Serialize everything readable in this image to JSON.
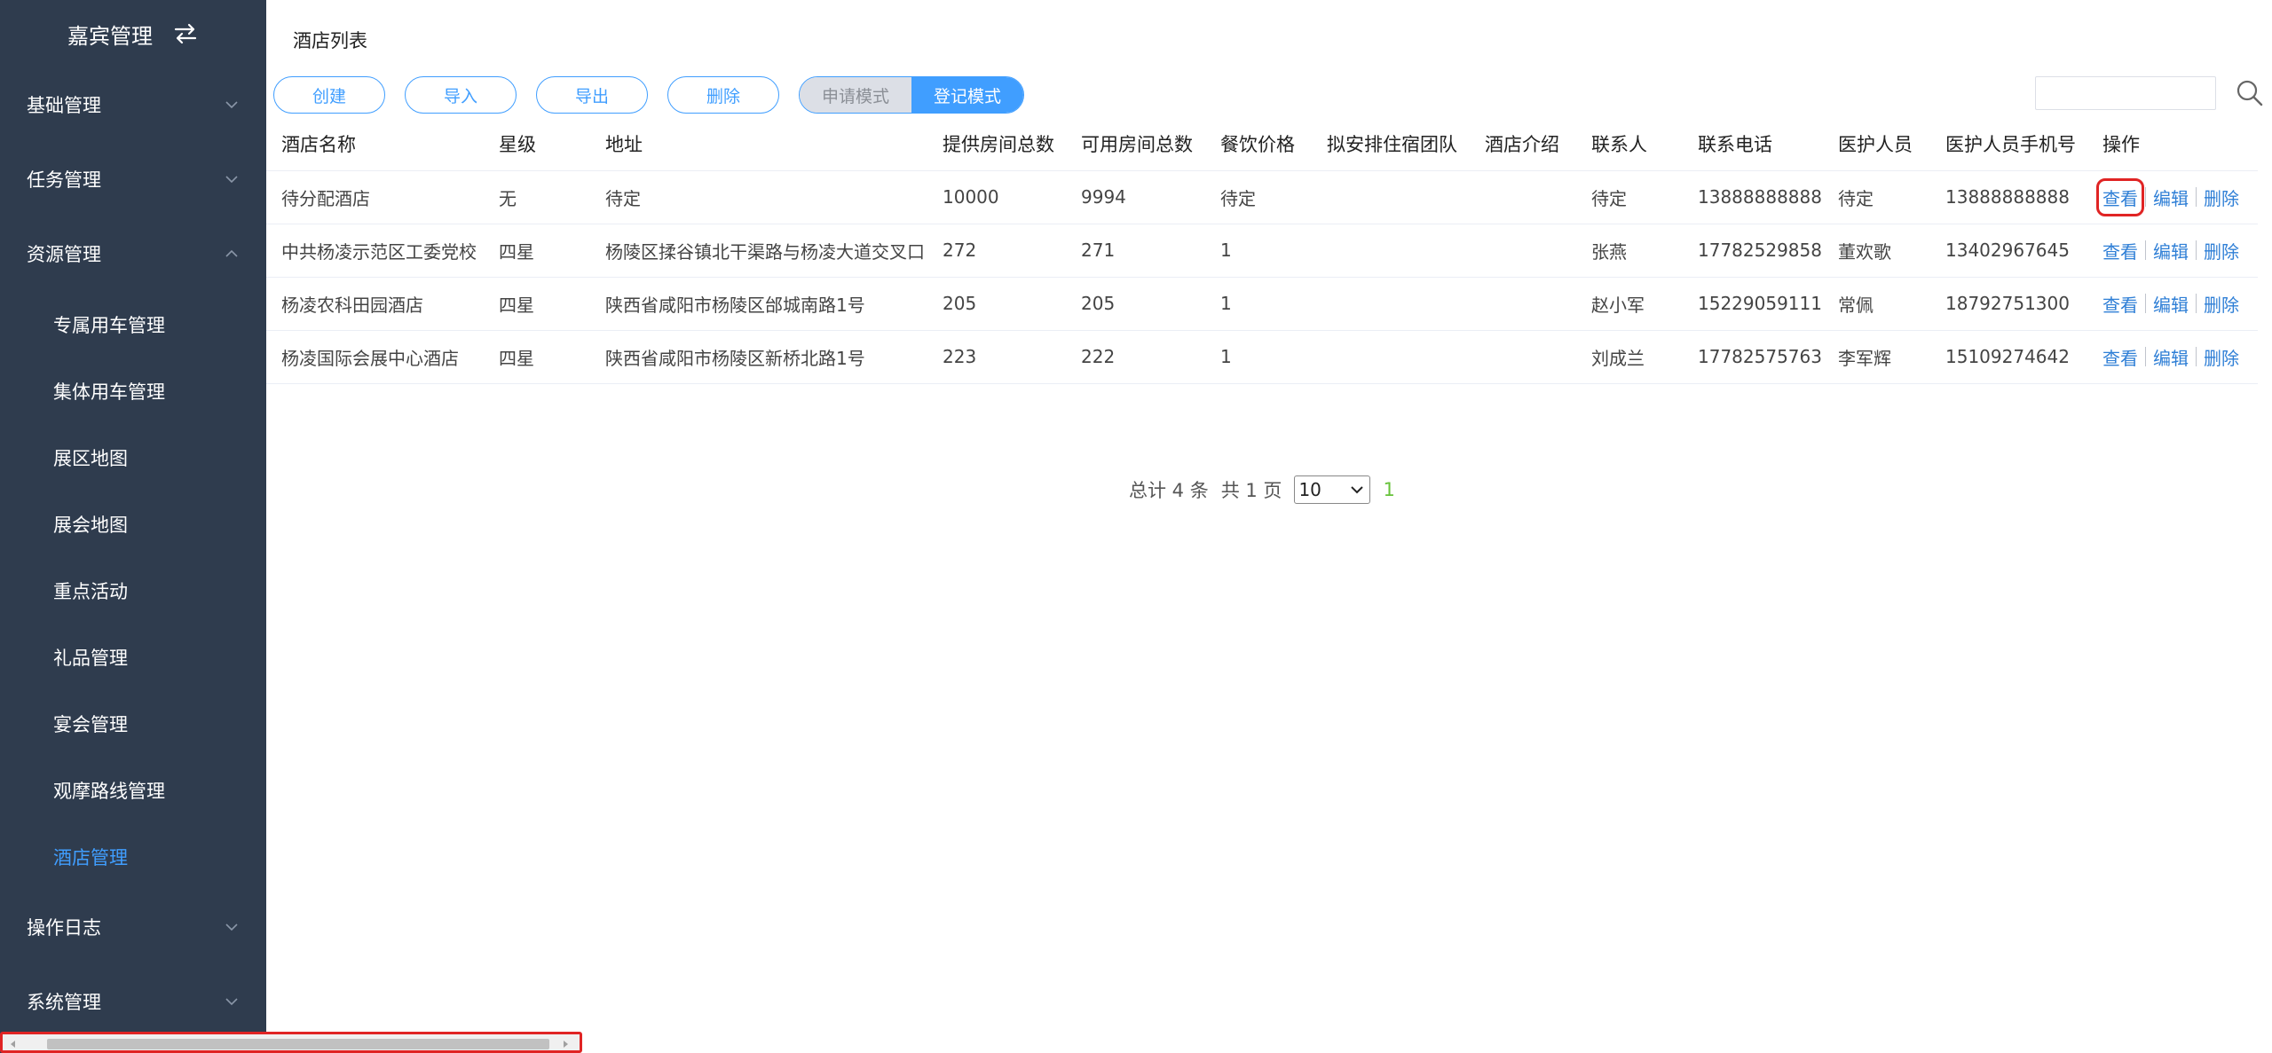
{
  "sidebar": {
    "brand": "嘉宾管理",
    "groups": [
      {
        "label": "基础管理"
      },
      {
        "label": "任务管理"
      },
      {
        "label": "资源管理"
      }
    ],
    "resource_items": [
      "专属用车管理",
      "集体用车管理",
      "展区地图",
      "展会地图",
      "重点活动",
      "礼品管理",
      "宴会管理",
      "观摩路线管理",
      "酒店管理"
    ],
    "bottom_groups": [
      {
        "label": "操作日志"
      },
      {
        "label": "系统管理"
      }
    ]
  },
  "main": {
    "title": "酒店列表",
    "toolbar": {
      "create": "创建",
      "import": "导入",
      "export": "导出",
      "delete": "删除",
      "mode_apply": "申请模式",
      "mode_register": "登记模式"
    },
    "search": {
      "value": ""
    },
    "table": {
      "headers": [
        "酒店名称",
        "星级",
        "地址",
        "提供房间总数",
        "可用房间总数",
        "餐饮价格",
        "拟安排住宿团队",
        "酒店介绍",
        "联系人",
        "联系电话",
        "医护人员",
        "医护人员手机号",
        "操作"
      ],
      "rows": [
        [
          "待分配酒店",
          "无",
          "待定",
          "10000",
          "9994",
          "待定",
          "",
          "",
          "待定",
          "13888888888",
          "待定",
          "13888888888"
        ],
        [
          "中共杨凌示范区工委党校",
          "四星",
          "杨陵区揉谷镇北干渠路与杨凌大道交叉口",
          "272",
          "271",
          "1",
          "",
          "",
          "张燕",
          "17782529858",
          "董欢歌",
          "13402967645"
        ],
        [
          "杨凌农科田园酒店",
          "四星",
          "陕西省咸阳市杨陵区邰城南路1号",
          "205",
          "205",
          "1",
          "",
          "",
          "赵小军",
          "15229059111",
          "常佩",
          "18792751300"
        ],
        [
          "杨凌国际会展中心酒店",
          "四星",
          "陕西省咸阳市杨陵区新桥北路1号",
          "223",
          "222",
          "1",
          "",
          "",
          "刘成兰",
          "17782575763",
          "李军辉",
          "15109274642"
        ]
      ],
      "ops": {
        "view": "查看",
        "edit": "编辑",
        "delete": "删除"
      }
    },
    "pagination": {
      "total": "总计 4 条",
      "pages": "共 1 页",
      "page_size": "10",
      "current": "1"
    }
  },
  "colors": {
    "sidebar_bg": "#2f3c4e",
    "accent": "#409eff",
    "highlight": "#e02424"
  }
}
